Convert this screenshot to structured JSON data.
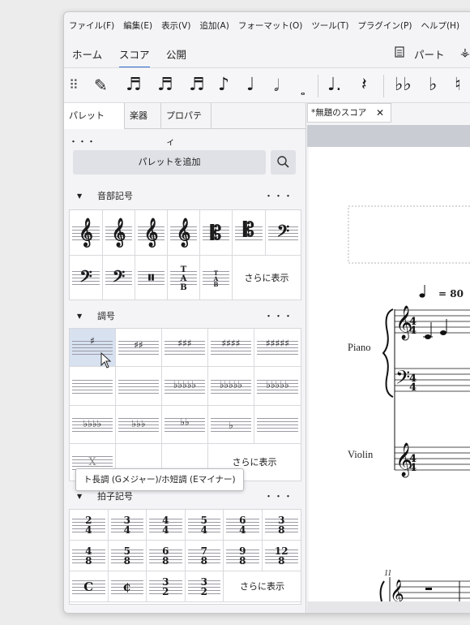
{
  "menu": [
    "ファイル(F)",
    "編集(E)",
    "表示(V)",
    "追加(A)",
    "フォーマット(O)",
    "ツール(T)",
    "プラグイン(P)",
    "ヘルプ(H)"
  ],
  "tabs": {
    "home": "ホーム",
    "score": "スコア",
    "publish": "公開",
    "parts": "パート"
  },
  "palette_tabs": {
    "palette": "パレット",
    "more": "・・・",
    "instruments": "楽器",
    "properties": "プロパティ"
  },
  "add_palette": "パレットを追加",
  "sections": {
    "clefs": {
      "title": "音部記号",
      "more": "・・・"
    },
    "keys": {
      "title": "調号",
      "more": "・・・"
    },
    "time": {
      "title": "拍子記号",
      "more": "・・・"
    }
  },
  "show_more": "さらに表示",
  "tooltip": "ト長調 (Gメジャー)/ホ短調 (Eマイナー)",
  "document": {
    "tab": "*無題のスコア",
    "tempo": "= 80",
    "instrument1": "Piano",
    "instrument2": "Violin",
    "measure": "11"
  },
  "time_sigs": [
    [
      "2",
      "4"
    ],
    [
      "3",
      "4"
    ],
    [
      "4",
      "4"
    ],
    [
      "5",
      "4"
    ],
    [
      "6",
      "4"
    ],
    [
      "3",
      "8"
    ],
    [
      "4",
      "8"
    ],
    [
      "5",
      "8"
    ],
    [
      "6",
      "8"
    ],
    [
      "7",
      "8"
    ],
    [
      "9",
      "8"
    ],
    [
      "12",
      "8"
    ],
    [
      "C",
      ""
    ],
    [
      "¢",
      ""
    ],
    [
      "3",
      "2"
    ],
    [
      "3",
      "2"
    ]
  ],
  "colors": {
    "accent": "#2f6fd0",
    "selected": "#d7e1f0"
  }
}
